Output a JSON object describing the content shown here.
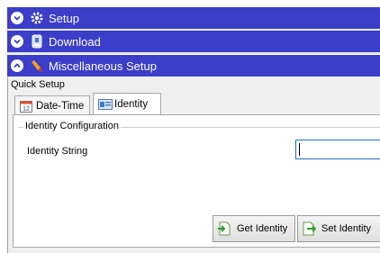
{
  "sections": [
    {
      "label": "Setup",
      "icon": "gear-icon",
      "expanded": false
    },
    {
      "label": "Download",
      "icon": "download-icon",
      "expanded": false
    },
    {
      "label": "Miscellaneous Setup",
      "icon": "wrench-icon",
      "expanded": true
    }
  ],
  "quick_setup": {
    "title": "Quick Setup",
    "tabs": [
      {
        "label": "Date-Time",
        "icon": "calendar-icon",
        "active": false
      },
      {
        "label": "Identity",
        "icon": "identity-card-icon",
        "active": true
      }
    ]
  },
  "identity": {
    "group_title": "Identity Configuration",
    "field_label": "Identity String",
    "field_value": "",
    "get_button": "Get Identity",
    "set_button": "Set Identity"
  },
  "colors": {
    "section_bar": "#3a3ec8",
    "panel_bg": "#f0f0f0",
    "input_border": "#1e6fc8"
  }
}
